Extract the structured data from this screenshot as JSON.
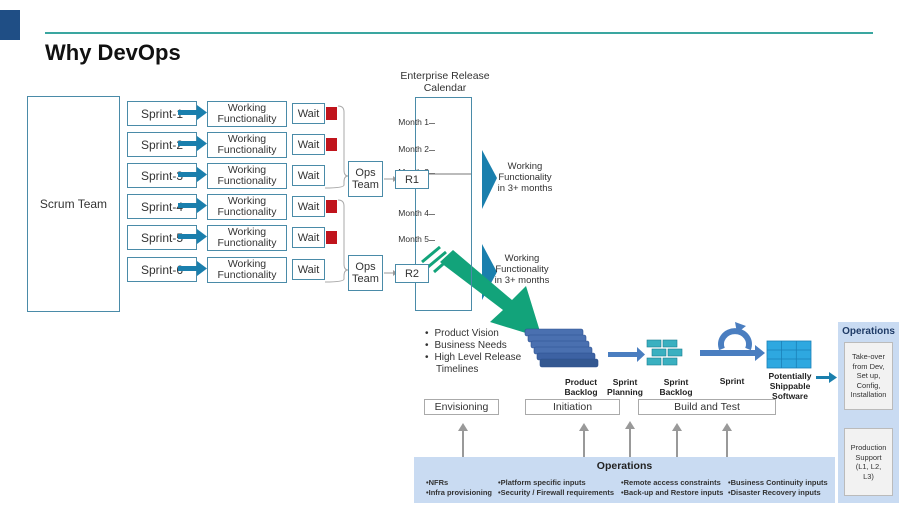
{
  "page": {
    "title": "Why DevOps"
  },
  "colors": {
    "accent_teal": "#3aa6a0",
    "corner_blue": "#1f4e85",
    "box_border": "#4a8ba8",
    "arrow_blue": "#1a7fad",
    "wait_red": "#c0141c",
    "big_arrow_green": "#12a37a",
    "ops_band": "#c9dbf2"
  },
  "waterfall": {
    "scrum_team": "Scrum Team",
    "sprints": [
      {
        "label": "Sprint-1",
        "output": [
          "Working",
          "Functionality"
        ],
        "wait": "Wait",
        "blocked": true
      },
      {
        "label": "Sprint-2",
        "output": [
          "Working",
          "Functionality"
        ],
        "wait": "Wait",
        "blocked": true
      },
      {
        "label": "Sprint-3",
        "output": [
          "Working",
          "Functionality"
        ],
        "wait": "Wait",
        "blocked": false
      },
      {
        "label": "Sprint-4",
        "output": [
          "Working",
          "Functionality"
        ],
        "wait": "Wait",
        "blocked": true
      },
      {
        "label": "Sprint-5",
        "output": [
          "Working",
          "Functionality"
        ],
        "wait": "Wait",
        "blocked": true
      },
      {
        "label": "Sprint-6",
        "output": [
          "Working",
          "Functionality"
        ],
        "wait": "Wait",
        "blocked": false
      }
    ],
    "ops_teams": [
      {
        "label": [
          "Ops",
          "Team"
        ],
        "release": "R1"
      },
      {
        "label": [
          "Ops",
          "Team"
        ],
        "release": "R2"
      }
    ],
    "calendar": {
      "title": [
        "Enterprise Release",
        "Calendar"
      ],
      "months": [
        "Month 1",
        "Month 2",
        "Month 3",
        "Month 4",
        "Month 5"
      ]
    },
    "outcomes": [
      [
        "Working",
        "Functionality",
        "in 3+ months"
      ],
      [
        "Working",
        "Functionality",
        "in 3+ months"
      ]
    ]
  },
  "agile": {
    "envisioning_bullets": [
      "Product Vision",
      "Business Needs",
      "High Level Release",
      "Timelines"
    ],
    "stages": {
      "product_backlog": [
        "Product",
        "Backlog"
      ],
      "sprint_planning": [
        "Sprint",
        "Planning"
      ],
      "sprint_backlog": [
        "Sprint",
        "Backlog"
      ],
      "sprint": [
        "Sprint"
      ],
      "shippable": [
        "Potentially",
        "Shippable",
        "Software"
      ]
    },
    "phases": [
      "Envisioning",
      "Initiation",
      "Build and Test"
    ]
  },
  "operations_band": {
    "title": "Operations",
    "columns": [
      [
        "NFRs",
        "Infra provisioning"
      ],
      [
        "Platform specific inputs",
        "Security / Firewall requirements"
      ],
      [
        "Remote access constraints",
        "Back-up and Restore inputs"
      ],
      [
        "Business Continuity inputs",
        "Disaster Recovery inputs"
      ]
    ]
  },
  "operations_side": {
    "title": "Operations",
    "boxes": [
      [
        "Take-over",
        "from Dev,",
        "Set up,",
        "Config,",
        "Installation"
      ],
      [
        "Production",
        "Support",
        "(L1, L2,",
        "L3)"
      ]
    ]
  }
}
